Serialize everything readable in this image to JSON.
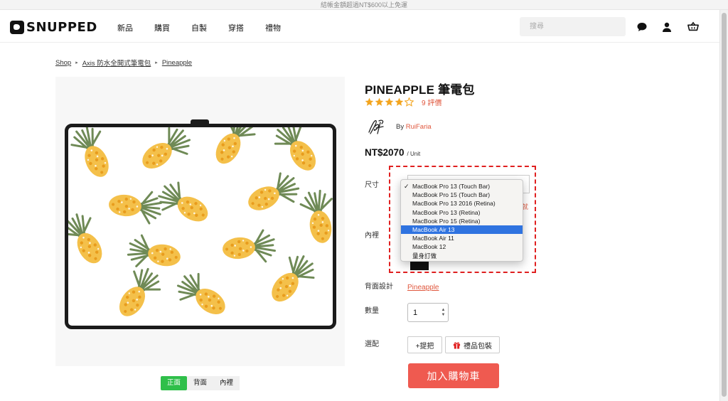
{
  "topbar": {
    "notice": "結帳金額超過NT$600以上免運"
  },
  "header": {
    "logo_text": "SNUPPED",
    "nav": [
      "新品",
      "購買",
      "自製",
      "穿搭",
      "禮物"
    ],
    "search_placeholder": "搜尋",
    "icons": [
      "chat-icon",
      "user-icon",
      "cart-icon"
    ]
  },
  "breadcrumb": [
    "Shop",
    "Axis 防水全開式筆電包",
    "Pineapple"
  ],
  "product": {
    "title": "PINEAPPLE 筆電包",
    "rating": 4,
    "rating_max": 5,
    "reviews": "9 評價",
    "by": "By",
    "designer": "RuiFaria",
    "price": "NT$2070",
    "unit": "/ Unit"
  },
  "options": {
    "size_label": "尺寸",
    "lining_label": "內裡",
    "back_design_label": "背面設計",
    "back_design_value": "Pineapple",
    "quantity_label": "數量",
    "quantity_value": "1",
    "addons_label": "選配",
    "handle_button": "+提把",
    "gift_button": "禮品包裝",
    "cart_button": "加入購物車",
    "size_note_fragment": "就",
    "dropdown": {
      "items": [
        "MacBook Pro 13 (Touch Bar)",
        "MacBook Pro 15 (Touch Bar)",
        "MacBook Pro 13 2016 (Retina)",
        "MacBook Pro 13 (Retina)",
        "MacBook Pro 15 (Retina)",
        "MacBook Air 13",
        "MacBook Air 11",
        "MacBook 12",
        "量身訂做"
      ],
      "checked": "MacBook Pro 13 (Touch Bar)",
      "highlighted": "MacBook Air 13",
      "check_mark": "✓"
    }
  },
  "view_tabs": [
    "正面",
    "背面",
    "內裡"
  ],
  "view_tabs_active": "正面",
  "colors": {
    "accent": "#e0573d",
    "cart": "#ef5a50",
    "active_tab": "#2fbf4a",
    "highlight_border": "#e02020",
    "selection": "#2f73e0"
  }
}
